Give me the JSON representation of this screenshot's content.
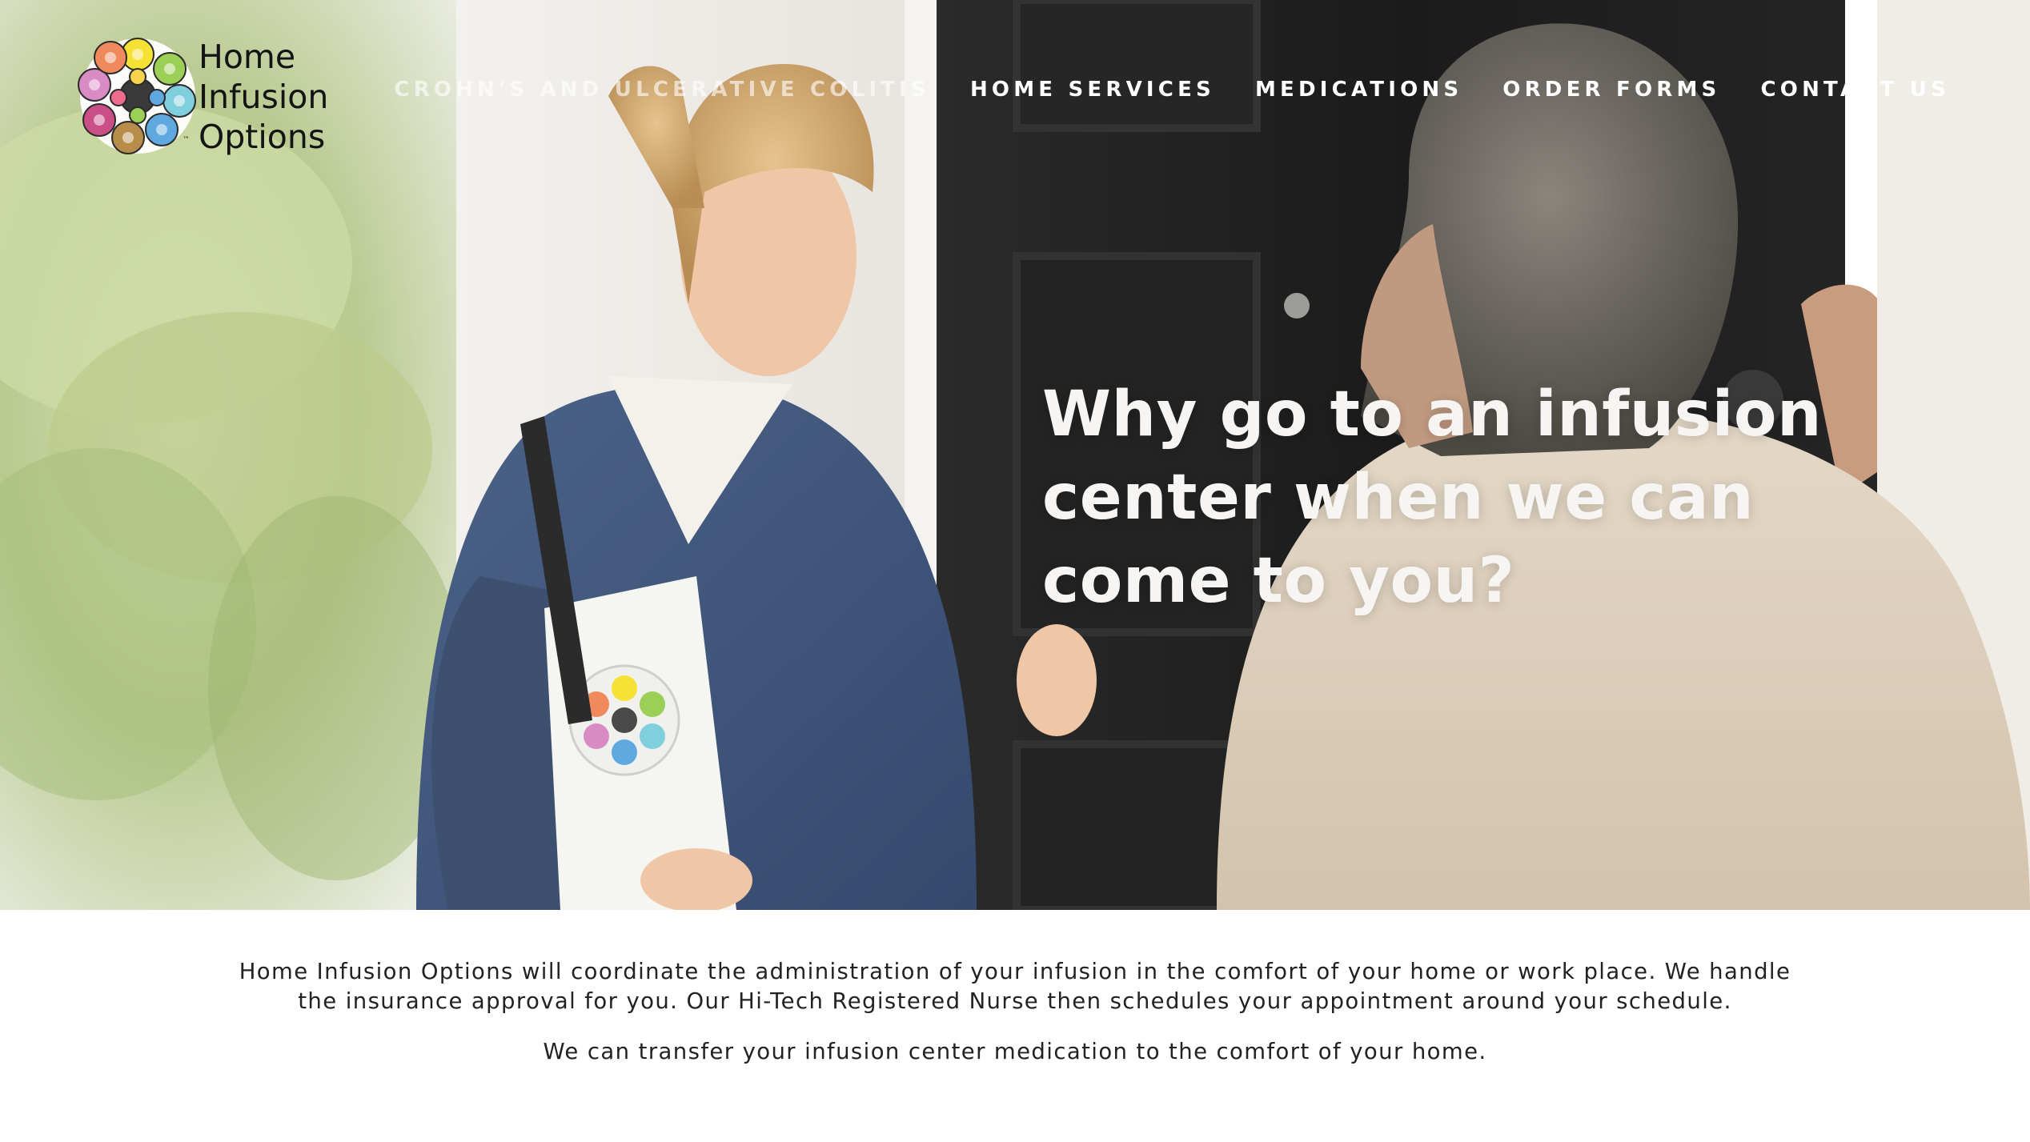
{
  "brand": {
    "name_lines": [
      "Home",
      "Infusion",
      "Options"
    ],
    "trademark": "™",
    "colors": [
      "#f6e234",
      "#9ccf55",
      "#7fd0dc",
      "#5fa9e0",
      "#d98bc4",
      "#c94f86",
      "#f08a5d",
      "#b88d4a"
    ]
  },
  "nav": {
    "items": [
      {
        "label": "CROHN'S AND ULCERATIVE COLITIS"
      },
      {
        "label": "HOME SERVICES"
      },
      {
        "label": "MEDICATIONS"
      },
      {
        "label": "ORDER FORMS"
      },
      {
        "label": "CONTACT US"
      }
    ]
  },
  "hero": {
    "headline": "Why go to an infusion center when we can come to you?",
    "image": "photo-nurse-at-patient-door"
  },
  "content": {
    "paragraph1": "Home Infusion Options will coordinate the administration of your infusion in the comfort of your home or work place. We handle the insurance approval for you. Our Hi-Tech Registered Nurse then schedules your appointment around your schedule.",
    "paragraph2": "We can transfer your infusion center medication to the comfort of your home."
  }
}
